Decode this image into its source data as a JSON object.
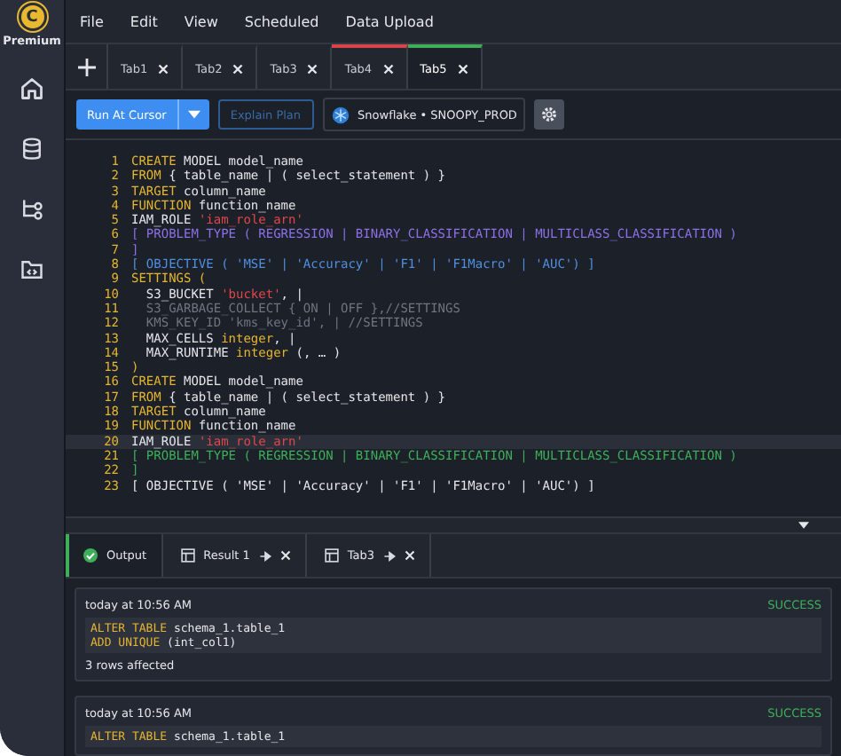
{
  "brand": {
    "logo": "C",
    "label": "Premium"
  },
  "sidebar": {
    "items": [
      {
        "kind": "home"
      },
      {
        "kind": "database"
      },
      {
        "kind": "flow"
      },
      {
        "kind": "folder"
      }
    ]
  },
  "menu": [
    "File",
    "Edit",
    "View",
    "Scheduled",
    "Data Upload"
  ],
  "tabs": [
    {
      "label": "Tab1",
      "selected": false
    },
    {
      "label": "Tab2",
      "selected": false
    },
    {
      "label": "Tab3",
      "selected": false
    },
    {
      "label": "Tab4",
      "selected": false,
      "color": "#d9434a"
    },
    {
      "label": "Tab5",
      "selected": true,
      "color": "#3fae5a"
    }
  ],
  "toolbar": {
    "run": "Run At Cursor",
    "explain": "Explain Plan",
    "connection": "Snowflake • SNOOPY_PROD"
  },
  "code": [
    {
      "number": "1",
      "tokens": [
        {
          "kind": "kw",
          "text": "CREATE"
        },
        {
          "kind": "plain",
          "text": " MODEL model_name"
        }
      ]
    },
    {
      "number": "2",
      "tokens": [
        {
          "kind": "kw",
          "text": "FROM"
        },
        {
          "kind": "plain",
          "text": " { table_name | ( select_statement ) }"
        }
      ]
    },
    {
      "number": "3",
      "tokens": [
        {
          "kind": "kw",
          "text": "TARGET"
        },
        {
          "kind": "plain",
          "text": " column_name"
        }
      ]
    },
    {
      "number": "4",
      "tokens": [
        {
          "kind": "kw",
          "text": "FUNCTION"
        },
        {
          "kind": "plain",
          "text": " function_name"
        }
      ]
    },
    {
      "number": "5",
      "tokens": [
        {
          "kind": "plain",
          "text": "IAM_ROLE "
        },
        {
          "kind": "str",
          "text": "'iam_role_arn'"
        }
      ]
    },
    {
      "number": "6",
      "tokens": [
        {
          "kind": "purple",
          "text": "[ PROBLEM_TYPE ( REGRESSION | BINARY_CLASSIFICATION | MULTICLASS_CLASSIFICATION )"
        }
      ]
    },
    {
      "number": "7",
      "tokens": [
        {
          "kind": "purple",
          "text": "]"
        }
      ]
    },
    {
      "number": "8",
      "tokens": [
        {
          "kind": "blue",
          "text": "[ OBJECTIVE ( 'MSE' | 'Accuracy' | 'F1' | 'F1Macro' | 'AUC') ]"
        }
      ]
    },
    {
      "number": "9",
      "tokens": [
        {
          "kind": "kw",
          "text": "SETTINGS ("
        }
      ]
    },
    {
      "number": "10",
      "tokens": [
        {
          "kind": "plain",
          "text": "  S3_BUCKET "
        },
        {
          "kind": "str",
          "text": "'bucket'"
        },
        {
          "kind": "plain",
          "text": ", |"
        }
      ]
    },
    {
      "number": "11",
      "tokens": [
        {
          "kind": "comment",
          "text": "  S3_GARBAGE_COLLECT { ON | OFF },//SETTINGS"
        }
      ]
    },
    {
      "number": "12",
      "tokens": [
        {
          "kind": "comment",
          "text": "  KMS_KEY_ID 'kms_key_id', | //SETTINGS"
        }
      ]
    },
    {
      "number": "13",
      "tokens": [
        {
          "kind": "plain",
          "text": "  MAX_CELLS "
        },
        {
          "kind": "kw",
          "text": "integer"
        },
        {
          "kind": "plain",
          "text": ", |"
        }
      ]
    },
    {
      "number": "14",
      "tokens": [
        {
          "kind": "plain",
          "text": "  MAX_RUNTIME "
        },
        {
          "kind": "kw",
          "text": "integer"
        },
        {
          "kind": "plain",
          "text": " (, … )"
        }
      ]
    },
    {
      "number": "15",
      "tokens": [
        {
          "kind": "kw",
          "text": ")"
        }
      ]
    },
    {
      "number": "16",
      "tokens": [
        {
          "kind": "kw",
          "text": "CREATE"
        },
        {
          "kind": "plain",
          "text": " MODEL model_name"
        }
      ]
    },
    {
      "number": "17",
      "tokens": [
        {
          "kind": "kw",
          "text": "FROM"
        },
        {
          "kind": "plain",
          "text": " { table_name | ( select_statement ) }"
        }
      ]
    },
    {
      "number": "18",
      "tokens": [
        {
          "kind": "kw",
          "text": "TARGET"
        },
        {
          "kind": "plain",
          "text": " column_name"
        }
      ]
    },
    {
      "number": "19",
      "tokens": [
        {
          "kind": "kw",
          "text": "FUNCTION"
        },
        {
          "kind": "plain",
          "text": " function_name"
        }
      ]
    },
    {
      "number": "20",
      "highlighted": true,
      "tokens": [
        {
          "kind": "plain",
          "text": "IAM_ROLE "
        },
        {
          "kind": "str",
          "text": "'iam_role_arn'"
        }
      ]
    },
    {
      "number": "21",
      "tokens": [
        {
          "kind": "green",
          "text": "[ PROBLEM_TYPE ( REGRESSION | BINARY_CLASSIFICATION | MULTICLASS_CLASSIFICATION )"
        }
      ]
    },
    {
      "number": "22",
      "tokens": [
        {
          "kind": "green",
          "text": "]"
        }
      ]
    },
    {
      "number": "23",
      "tokens": [
        {
          "kind": "plain",
          "text": "[ OBJECTIVE ( 'MSE' | 'Accuracy' | 'F1' | 'F1Macro' | 'AUC') ]"
        }
      ]
    }
  ],
  "result_tabs": [
    {
      "kind": "output",
      "label": "Output",
      "selected": true
    },
    {
      "kind": "result",
      "label": "Result 1",
      "selected": false
    },
    {
      "kind": "result",
      "label": "Tab3",
      "selected": false
    }
  ],
  "results": [
    {
      "time": "today at 10:56 AM",
      "status": "SUCCESS",
      "code": [
        [
          {
            "kind": "kw",
            "text": "ALTER TABLE"
          },
          {
            "kind": "plain",
            "text": " schema_1.table_1"
          }
        ],
        [
          {
            "kind": "kw",
            "text": "ADD UNIQUE"
          },
          {
            "kind": "plain",
            "text": " (int_col1)"
          }
        ]
      ],
      "message": "3 rows affected"
    },
    {
      "time": "today at 10:56 AM",
      "status": "SUCCESS",
      "code": [
        [
          {
            "kind": "kw",
            "text": "ALTER TABLE"
          },
          {
            "kind": "plain",
            "text": " schema_1.table_1"
          }
        ]
      ]
    }
  ]
}
